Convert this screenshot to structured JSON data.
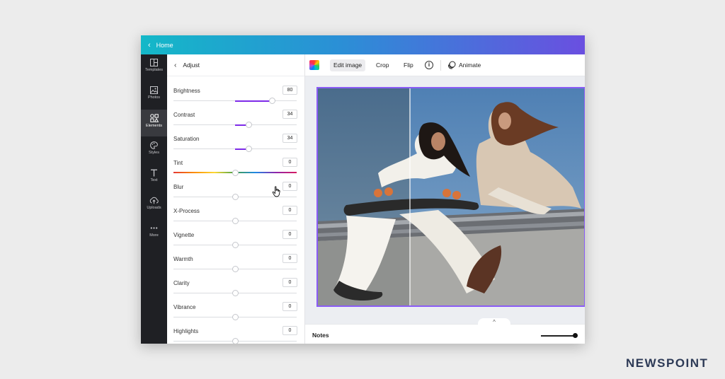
{
  "topbar": {
    "home_label": "Home"
  },
  "rail": {
    "items": [
      {
        "label": "Templates",
        "icon": "templates-icon",
        "active": false
      },
      {
        "label": "Photos",
        "icon": "photos-icon",
        "active": false
      },
      {
        "label": "Elements",
        "icon": "elements-icon",
        "active": true
      },
      {
        "label": "Styles",
        "icon": "styles-icon",
        "active": false
      },
      {
        "label": "Text",
        "icon": "text-icon",
        "active": false
      },
      {
        "label": "Uploads",
        "icon": "uploads-icon",
        "active": false
      },
      {
        "label": "More",
        "icon": "more-icon",
        "active": false
      }
    ]
  },
  "panel": {
    "title": "Adjust",
    "adjustments": [
      {
        "name": "Brightness",
        "value": "80"
      },
      {
        "name": "Contrast",
        "value": "34"
      },
      {
        "name": "Saturation",
        "value": "34"
      },
      {
        "name": "Tint",
        "value": "0"
      },
      {
        "name": "Blur",
        "value": "0"
      },
      {
        "name": "X-Process",
        "value": "0"
      },
      {
        "name": "Vignette",
        "value": "0"
      },
      {
        "name": "Warmth",
        "value": "0"
      },
      {
        "name": "Clarity",
        "value": "0"
      },
      {
        "name": "Vibrance",
        "value": "0"
      },
      {
        "name": "Highlights",
        "value": "0"
      }
    ]
  },
  "toolbar": {
    "edit_image": "Edit image",
    "crop": "Crop",
    "flip": "Flip",
    "info": "i",
    "animate": "Animate"
  },
  "notes": {
    "label": "Notes",
    "caret": "^"
  },
  "brand": {
    "text": "NEWSPOINT"
  },
  "colors": {
    "accent": "#7d2ae8",
    "selection": "#8b5cf6",
    "rail_bg": "#1f2024"
  }
}
